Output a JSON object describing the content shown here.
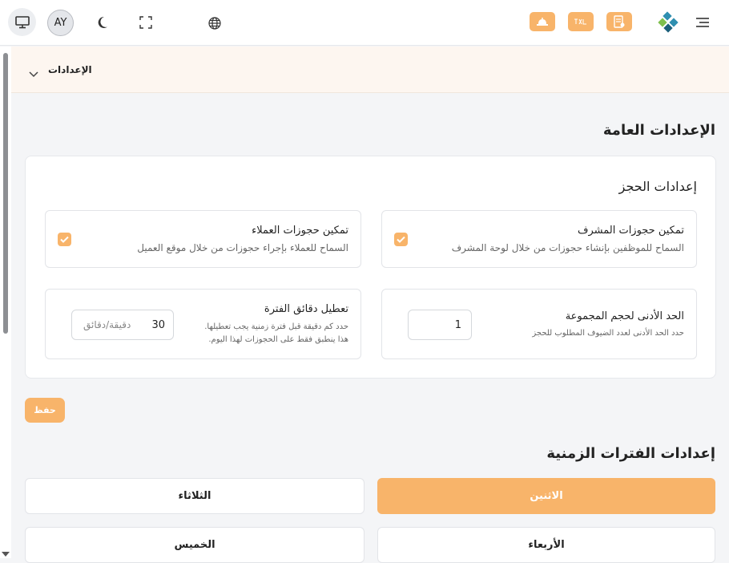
{
  "header": {
    "avatar_initials": "AY",
    "icons": [
      "monitor-icon",
      "moon-icon",
      "fullscreen-icon",
      "globe-icon",
      "bell-icon",
      "translate-icon",
      "document-icon",
      "logo-icon",
      "menu-icon"
    ]
  },
  "breadcrumb": {
    "label": "الإعدادات"
  },
  "general": {
    "title": "الإعدادات العامة",
    "card_title": "إعدادات الحجز",
    "admin_booking": {
      "title": "تمكين حجوزات المشرف",
      "description": "السماح للموظفين بإنشاء حجوزات من خلال لوحة المشرف",
      "checked": true
    },
    "customer_booking": {
      "title": "تمكين حجوزات العملاء",
      "description": "السماح للعملاء بإجراء حجوزات من خلال موقع العميل",
      "checked": true
    },
    "min_group": {
      "title": "الحد الأدنى لحجم المجموعة",
      "description": "حدد الحد الأدنى لعدد الضيوف المطلوب للحجز",
      "value": "1"
    },
    "disable_minutes": {
      "title": "تعطيل دقائق الفترة",
      "description_line1": "حدد كم دقيقة قبل فترة زمنية يجب تعطيلها.",
      "description_line2": "هذا ينطبق فقط على الحجوزات لهذا اليوم.",
      "value": "30",
      "unit": "دقيقة/دقائق"
    },
    "save_label": "حفظ"
  },
  "slots": {
    "title": "إعدادات الفترات الزمنية",
    "days": [
      {
        "label": "الاثنين",
        "active": true
      },
      {
        "label": "الثلاثاء",
        "active": false
      },
      {
        "label": "الأربعاء",
        "active": false
      },
      {
        "label": "الخميس",
        "active": false
      }
    ]
  },
  "colors": {
    "accent": "#f8b46a",
    "breadcrumb_bg": "#fdf6f0"
  }
}
